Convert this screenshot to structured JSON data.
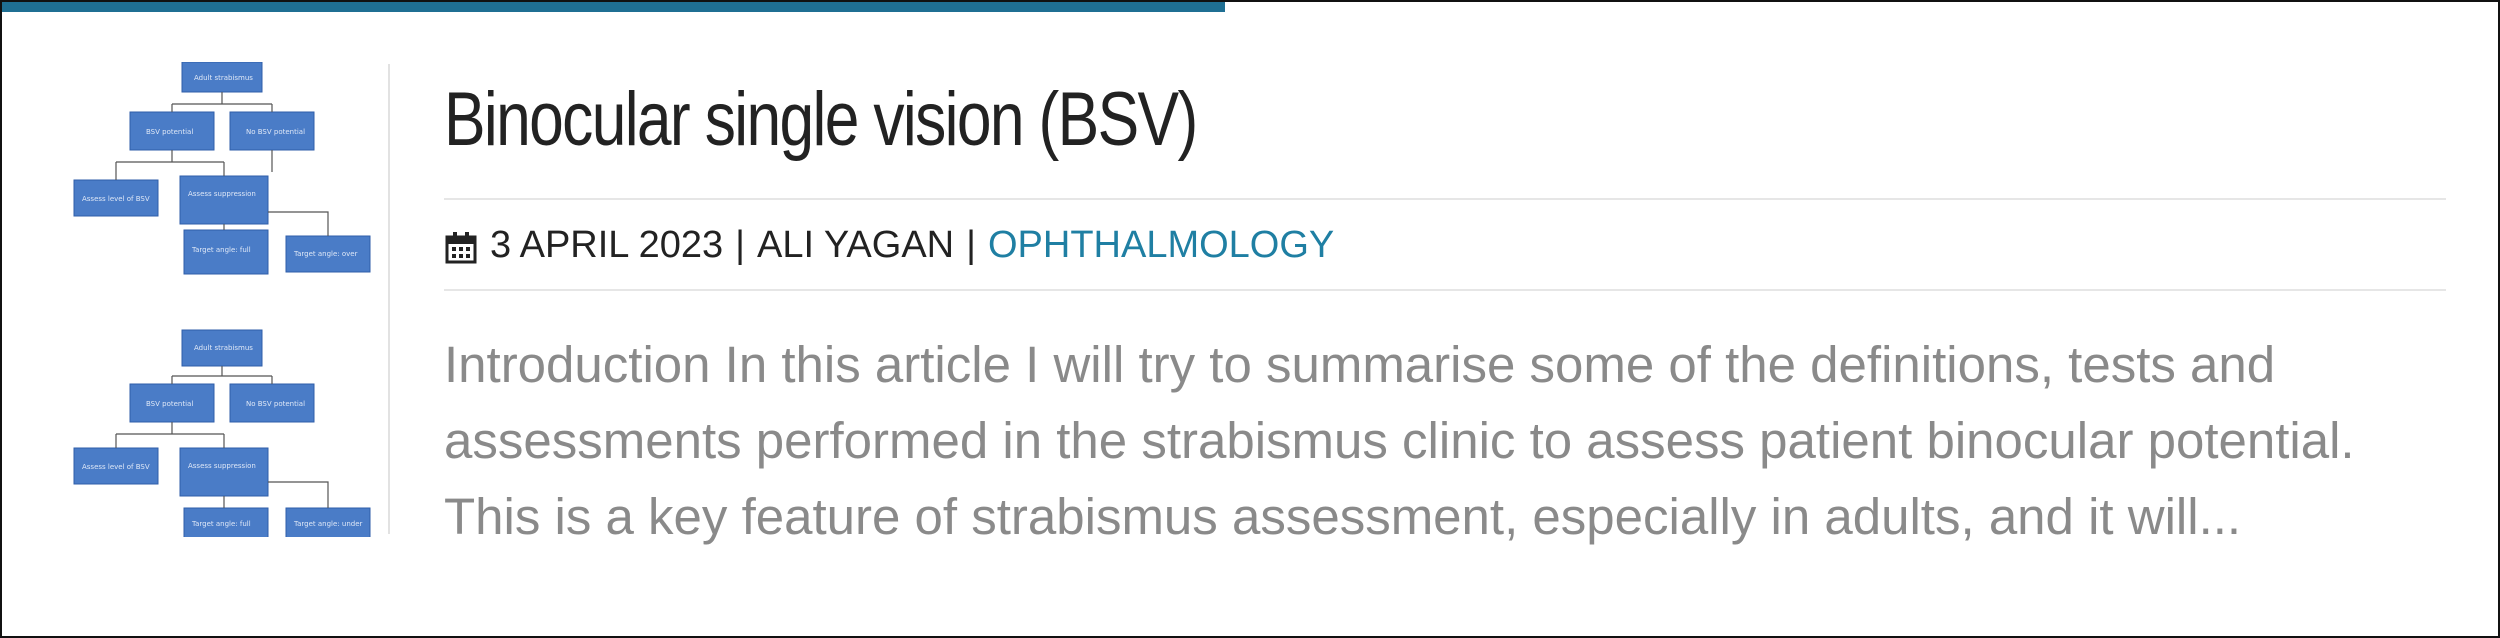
{
  "post": {
    "title": "Binocular single vision (BSV)",
    "date": "3 APRIL 2023",
    "author": "ALI YAGAN",
    "separator": "|",
    "category": "OPHTHALMOLOGY",
    "excerpt_lines": [
      "Introduction In this article I will try to summarise some of the definitions, tests and",
      "assessments performed in the strabismus clinic to assess patient binocular potential.",
      "This is a key feature of strabismus assessment, especially in adults, and it will..."
    ]
  },
  "colors": {
    "accent_bar": "#1f6f93",
    "category_link": "#1f7fa3",
    "title_text": "#222222",
    "excerpt_text": "#8a8a8a",
    "flowchart_box": "#4a7cc7"
  },
  "icons": {
    "date": "calendar-icon"
  }
}
